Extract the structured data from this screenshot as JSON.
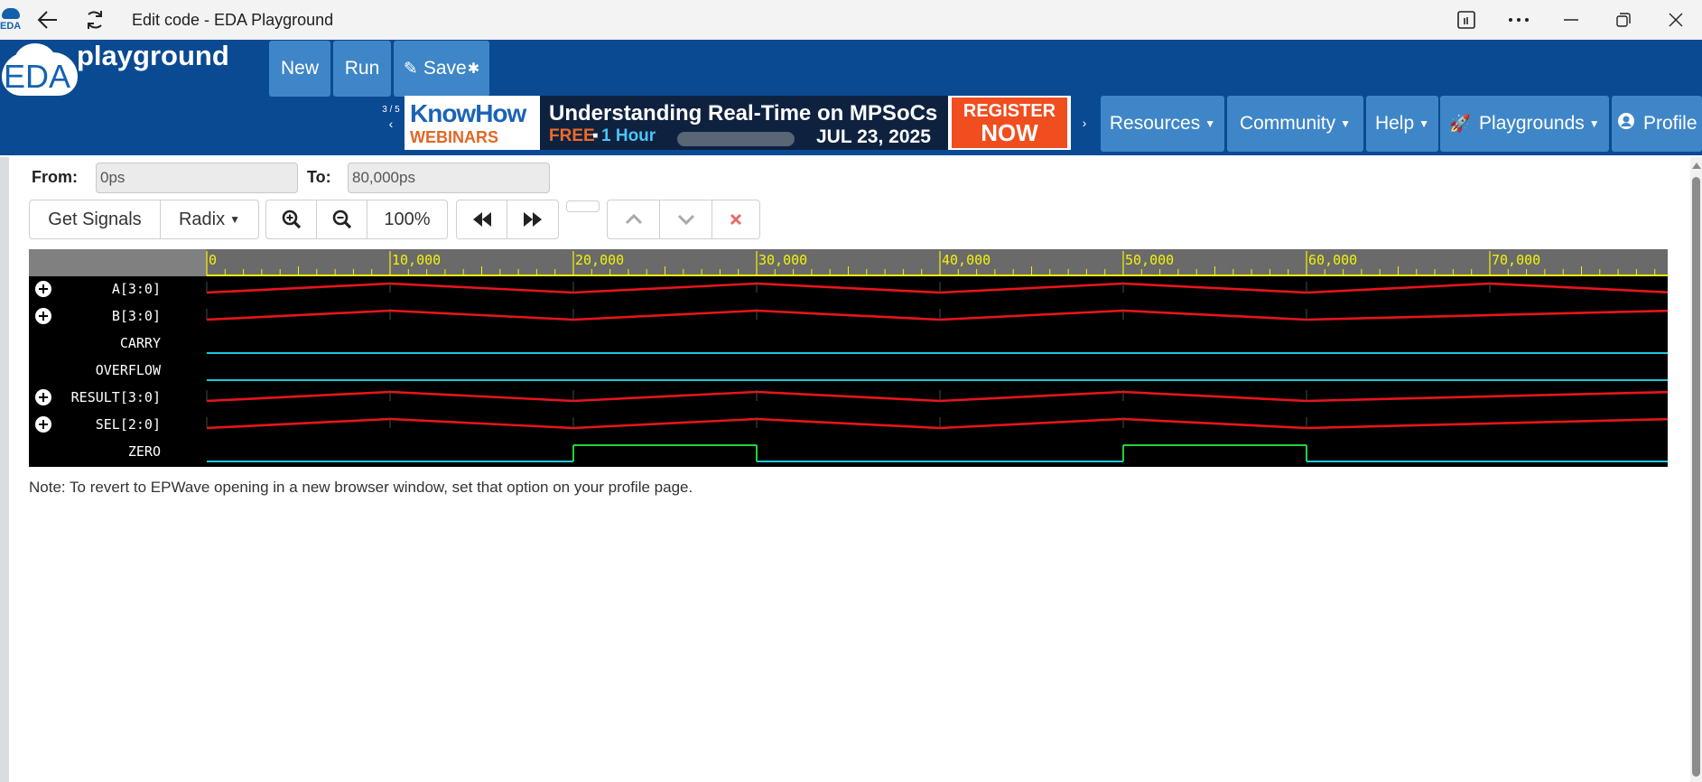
{
  "browser": {
    "tab_title": "Edit code - EDA Playground",
    "logo_text": "EDA"
  },
  "header": {
    "logo_eda": "EDA",
    "logo_playground": "playground",
    "buttons": {
      "new": "New",
      "run": "Run",
      "save": "Save"
    },
    "save_modified_mark": "✱",
    "ad": {
      "counter": "3 / 5",
      "brand_top": "KnowHow",
      "brand_bottom": "WEBINARS",
      "headline": "Understanding Real-Time on MPSoCs",
      "free": "FREE",
      "separator": "▪",
      "duration": "1 Hour",
      "date": "JUL 23, 2025",
      "cta_top": "REGISTER",
      "cta_bottom": "NOW"
    },
    "nav": {
      "resources": "Resources",
      "community": "Community",
      "help": "Help",
      "playgrounds": "Playgrounds",
      "profile": "Profile"
    }
  },
  "range": {
    "from_label": "From:",
    "from_value": "0ps",
    "to_label": "To:",
    "to_value": "80,000ps"
  },
  "toolbar": {
    "get_signals": "Get Signals",
    "radix": "Radix",
    "zoom_level": "100%"
  },
  "waveform": {
    "time_start": 0,
    "time_end": 80000,
    "ticks": [
      "0",
      "10,000",
      "20,000",
      "30,000",
      "40,000",
      "50,000",
      "60,000",
      "70,000"
    ],
    "tick_values": [
      0,
      10000,
      20000,
      30000,
      40000,
      50000,
      60000,
      70000
    ],
    "colors": {
      "bus": "#e8151b",
      "bit_low": "#1ec8d8",
      "bit_high": "#22d33a",
      "ruler_text": "#f2f20a"
    },
    "signals": [
      {
        "name": "A[3:0]",
        "expandable": true,
        "kind": "bus",
        "transitions": [
          0,
          10000,
          20000,
          30000,
          40000,
          50000,
          60000,
          70000
        ]
      },
      {
        "name": "B[3:0]",
        "expandable": true,
        "kind": "bus",
        "transitions": [
          0,
          10000,
          20000,
          30000,
          40000,
          50000,
          60000
        ]
      },
      {
        "name": "CARRY",
        "expandable": false,
        "kind": "bit",
        "segments": [
          [
            0,
            80000,
            0
          ]
        ]
      },
      {
        "name": "OVERFLOW",
        "expandable": false,
        "kind": "bit",
        "segments": [
          [
            0,
            80000,
            0
          ]
        ]
      },
      {
        "name": "RESULT[3:0]",
        "expandable": true,
        "kind": "bus",
        "transitions": [
          0,
          10000,
          20000,
          30000,
          40000,
          50000,
          60000
        ]
      },
      {
        "name": "SEL[2:0]",
        "expandable": true,
        "kind": "bus",
        "transitions": [
          0,
          10000,
          20000,
          30000,
          40000,
          50000,
          60000
        ]
      },
      {
        "name": "ZERO",
        "expandable": false,
        "kind": "bit",
        "segments": [
          [
            0,
            20000,
            0
          ],
          [
            20000,
            30000,
            1
          ],
          [
            30000,
            50000,
            0
          ],
          [
            50000,
            60000,
            1
          ],
          [
            60000,
            80000,
            0
          ]
        ]
      }
    ]
  },
  "note": "Note: To revert to EPWave opening in a new browser window, set that option on your profile page."
}
